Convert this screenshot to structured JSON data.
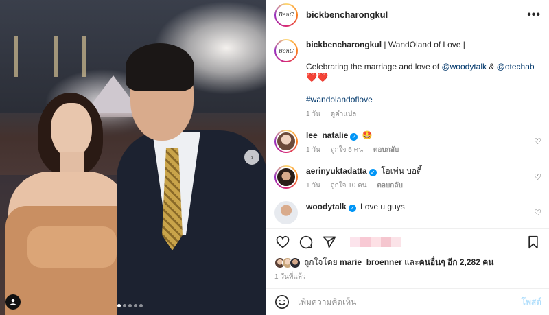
{
  "post": {
    "username": "bickbencharongkul",
    "avatar_logo_text": "BenC"
  },
  "caption": {
    "username": "bickbencharongkul",
    "title": "| WandOland of Love |",
    "line2_prefix": "Celebrating the marriage and love of ",
    "mention1": "@woodytalk",
    "amp": " & ",
    "mention2": "@otechab",
    "hearts": "❤️❤️",
    "hashtag": "#wandolandoflove",
    "time": "1 วัน",
    "translate": "ดูคำแปล"
  },
  "comments": [
    {
      "username": "lee_natalie",
      "text": "🤩",
      "time": "1 วัน",
      "likes": "ถูกใจ 5 คน",
      "reply": "ตอบกลับ",
      "verified": true,
      "ring": true
    },
    {
      "username": "aerinyuktadatta",
      "text": "โอเพ่น บอดี้",
      "time": "1 วัน",
      "likes": "ถูกใจ 10 คน",
      "reply": "ตอบกลับ",
      "verified": true,
      "ring": true
    },
    {
      "username": "woodytalk",
      "text": "Love u guys",
      "verified": true,
      "ring": false
    }
  ],
  "likes": {
    "prefix": "ถูกใจโดย ",
    "user": "marie_broenner",
    "middle": " และ",
    "others": "คนอื่นๆ อีก 2,282 คน"
  },
  "posted_time": "1 วันที่แล้ว",
  "add_comment": {
    "placeholder": "เพิ่มความคิดเห็น",
    "post_label": "โพสต์"
  },
  "icons": {
    "more": "more-icon",
    "heart": "heart-icon",
    "comment": "comment-icon",
    "share": "share-icon",
    "save": "bookmark-icon",
    "emoji": "emoji-icon",
    "tag": "user-tag-icon",
    "next": "chevron-right-icon"
  },
  "colors": {
    "link": "#00376b",
    "verified": "#0095f6",
    "post_disabled": "#b2dffc",
    "heart": "#ed4956"
  },
  "carousel": {
    "count": 5,
    "active": 1
  }
}
